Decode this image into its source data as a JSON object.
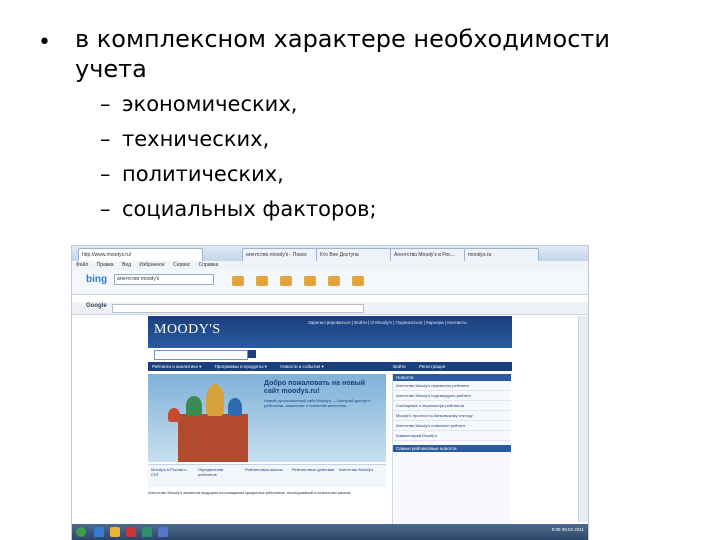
{
  "slide": {
    "bullet": "•",
    "main": "в комплексном характере необходимости учета",
    "subitems": [
      {
        "dash": "–",
        "text": "экономических,"
      },
      {
        "dash": "–",
        "text": "технических,"
      },
      {
        "dash": "–",
        "text": "политических,"
      },
      {
        "dash": "–",
        "text": "социальных факторов;"
      }
    ]
  },
  "screenshot": {
    "tabs": [
      "http://www.moodys.ru/",
      "агентство moody's - Поиск",
      "Кто Вне Доступа",
      "Агентство Moody's в Рос...",
      "moodys.ru"
    ],
    "menu": [
      "Файл",
      "Правка",
      "Вид",
      "Избранное",
      "Сервис",
      "Справка"
    ],
    "bing_logo": "bing",
    "bing_query": "агентство moody's",
    "google_logo": "Google",
    "site": {
      "logo": "MOODY'S",
      "toplinks": "Зарегистрироваться | Войти | О Moody's | Подписаться | Карьера | Контакты",
      "nav": [
        "Рейтинги и аналитика ▾",
        "Программы и продукты ▾",
        "Новости и события ▾",
        "Войти",
        "Регистрация"
      ],
      "hero_title": "Добро пожаловать на новый сайт moodys.ru!",
      "hero_text": "Новый русскоязычный сайт Moody's — быстрый доступ к рейтингам, аналитике и новостям агентства.",
      "tiles": [
        "Moody's в России и СНГ",
        "Определения рейтингов",
        "Рейтинговые шкалы",
        "Рейтинговые действия",
        "Агентство Moody's"
      ],
      "body": "Агентство Moody's является ведущим поставщиком кредитных рейтингов, исследований и аналитики рисков.",
      "side_head": "Новости",
      "side_items": [
        "Агентство Moody's присвоило рейтинги",
        "Агентство Moody's подтвердило рейтинг",
        "Сообщение о пересмотре рейтингов",
        "Moody's: прогноз по банковскому сектору",
        "Агентство Moody's повысило рейтинг",
        "Комментарий Moody's"
      ],
      "side_head2": "Самые рейтинговые новости"
    },
    "clock": "9:09\n08.02.2011"
  }
}
